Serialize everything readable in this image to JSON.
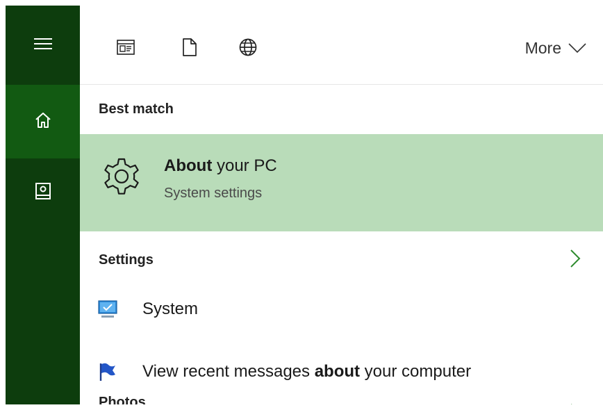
{
  "rail": {
    "items": [
      {
        "name": "menu",
        "icon": "hamburger-icon"
      },
      {
        "name": "home",
        "icon": "home-icon",
        "selected": true
      },
      {
        "name": "notebook",
        "icon": "notebook-icon"
      }
    ]
  },
  "topbar": {
    "filters": [
      {
        "icon": "apps-icon"
      },
      {
        "icon": "documents-icon"
      },
      {
        "icon": "web-icon"
      }
    ],
    "more_label": "More"
  },
  "best_match": {
    "heading": "Best match",
    "item": {
      "title_bold": "About",
      "title_rest": " your PC",
      "subtitle": "System settings",
      "icon": "gear-icon"
    }
  },
  "settings": {
    "heading": "Settings",
    "items": [
      {
        "label": "System",
        "icon": "monitor-icon"
      },
      {
        "label_pre": "View recent messages ",
        "label_bold": "about",
        "label_post": " your computer",
        "icon": "flag-icon"
      }
    ]
  },
  "photos": {
    "heading": "Photos"
  },
  "colors": {
    "rail_bg": "#0d3d0d",
    "rail_selected": "#125a12",
    "highlight": "#b9dcb9",
    "chevron": "#2e8b2e"
  }
}
